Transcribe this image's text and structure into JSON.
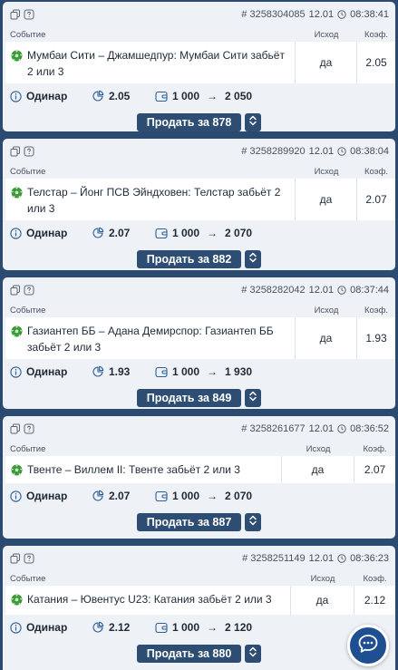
{
  "labels": {
    "event": "Событие",
    "outcome": "Исход",
    "coef": "Коэф.",
    "single": "Одинар",
    "arrow": "→"
  },
  "colors": {
    "background": "#2b4a6f",
    "card": "#eef1f6",
    "button": "#2d4d72",
    "chat": "#1d4f91",
    "ball": "#3d9a3a"
  },
  "bets": [
    {
      "id": "# 3258304085",
      "date": "12.01",
      "time": "08:38:41",
      "event": "Мумбаи Сити – Джамшедпур: Мумбаи Сити забьёт 2 или 3",
      "outcome": "да",
      "coef": "2.05",
      "odds": "2.05",
      "stake": "1 000",
      "payout": "2 050",
      "sell": "Продать за 878"
    },
    {
      "id": "# 3258289920",
      "date": "12.01",
      "time": "08:38:04",
      "event": "Телстар – Йонг ПСВ Эйндховен: Телстар забьёт 2 или 3",
      "outcome": "да",
      "coef": "2.07",
      "odds": "2.07",
      "stake": "1 000",
      "payout": "2 070",
      "sell": "Продать за 882"
    },
    {
      "id": "# 3258282042",
      "date": "12.01",
      "time": "08:37:44",
      "event": "Газиантеп ББ – Адана Демирспор: Газиантеп ББ забьёт 2 или 3",
      "outcome": "да",
      "coef": "1.93",
      "odds": "1.93",
      "stake": "1 000",
      "payout": "1 930",
      "sell": "Продать за 849"
    },
    {
      "id": "# 3258261677",
      "date": "12.01",
      "time": "08:36:52",
      "event": "Твенте – Виллем II: Твенте забьёт 2 или 3",
      "outcome": "да",
      "coef": "2.07",
      "odds": "2.07",
      "stake": "1 000",
      "payout": "2 070",
      "sell": "Продать за 887"
    },
    {
      "id": "# 3258251149",
      "date": "12.01",
      "time": "08:36:23",
      "event": "Катания – Ювентус U23: Катания забьёт 2 или 3",
      "outcome": "да",
      "coef": "2.12",
      "odds": "2.12",
      "stake": "1 000",
      "payout": "2 120",
      "sell": "Продать за 880"
    }
  ],
  "icons": {
    "copy": "copy-icon",
    "help": "help-icon",
    "clock": "clock-icon",
    "info": "info-icon",
    "odds": "odds-icon",
    "wallet": "wallet-icon",
    "ball": "soccer-ball-icon",
    "toggle": "up-down-arrows-icon",
    "chat": "chat-icon"
  }
}
